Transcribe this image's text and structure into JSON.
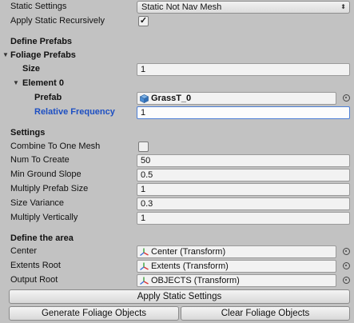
{
  "static_settings": {
    "label": "Static Settings",
    "value": "Static Not Nav Mesh"
  },
  "apply_static_recursively": {
    "label": "Apply Static Recursively",
    "checked": true
  },
  "define_prefabs": {
    "heading": "Define Prefabs"
  },
  "foliage_prefabs": {
    "label": "Foliage Prefabs",
    "size_label": "Size",
    "size_value": "1",
    "element": {
      "label": "Element 0",
      "prefab_label": "Prefab",
      "prefab_value": "GrassT_0",
      "frequency_label": "Relative Frequency",
      "frequency_value": "1"
    }
  },
  "settings": {
    "heading": "Settings",
    "combine": {
      "label": "Combine To One Mesh",
      "checked": false
    },
    "num_to_create": {
      "label": "Num To Create",
      "value": "50"
    },
    "min_ground_slope": {
      "label": "Min Ground Slope",
      "value": "0.5"
    },
    "multiply_prefab_size": {
      "label": "Multiply Prefab Size",
      "value": "1"
    },
    "size_variance": {
      "label": "Size Variance",
      "value": "0.3"
    },
    "multiply_vertically": {
      "label": "Multiply Vertically",
      "value": "1"
    }
  },
  "area": {
    "heading": "Define the area",
    "center": {
      "label": "Center",
      "value": "Center (Transform)"
    },
    "extents_root": {
      "label": "Extents Root",
      "value": "Extents (Transform)"
    },
    "output_root": {
      "label": "Output Root",
      "value": "OBJECTS (Transform)"
    }
  },
  "buttons": {
    "apply_static": "Apply Static Settings",
    "generate": "Generate Foliage Objects",
    "clear": "Clear Foliage Objects"
  },
  "icons": {
    "checkmark": "✓",
    "foldout_open": "▼",
    "dropdown_arrow": "⬍"
  },
  "colors": {
    "background": "#c2c2c2",
    "highlight_label": "#1d4fc2"
  }
}
